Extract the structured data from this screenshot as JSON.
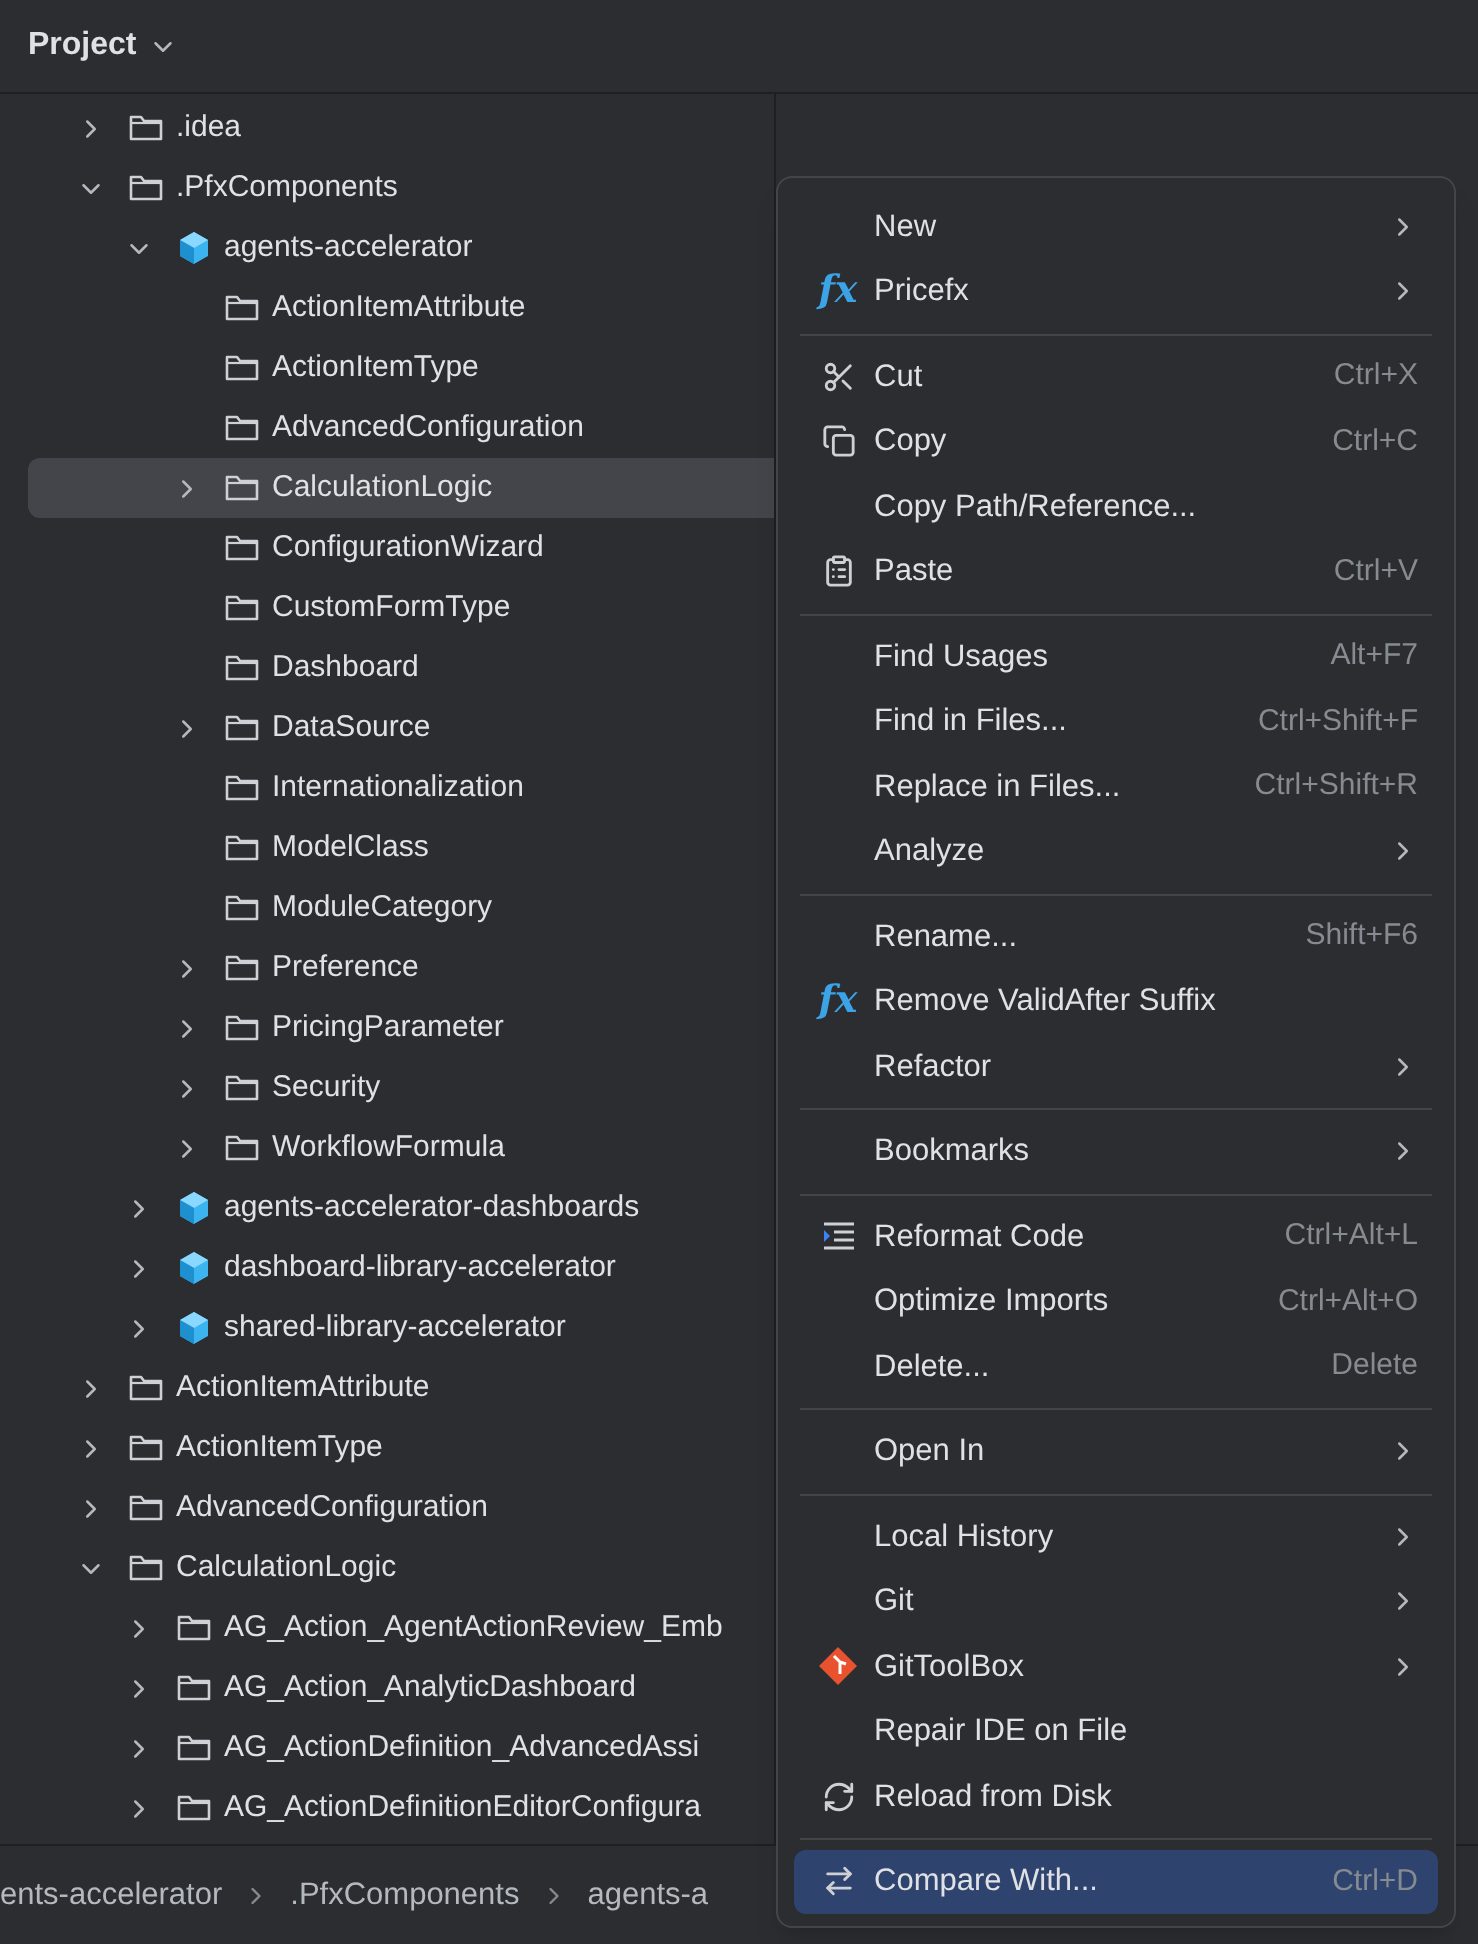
{
  "panel": {
    "title": "Project"
  },
  "tree": [
    {
      "label": ".idea",
      "kind": "folder",
      "expanded": false,
      "selected": false
    },
    {
      "label": ".PfxComponents",
      "kind": "folder",
      "expanded": true,
      "selected": false,
      "children": [
        {
          "label": "agents-accelerator",
          "kind": "module",
          "expanded": true,
          "selected": false,
          "children": [
            {
              "label": "ActionItemAttribute",
              "kind": "folder",
              "selected": false
            },
            {
              "label": "ActionItemType",
              "kind": "folder",
              "selected": false
            },
            {
              "label": "AdvancedConfiguration",
              "kind": "folder",
              "selected": false
            },
            {
              "label": "CalculationLogic",
              "kind": "folder",
              "expanded": false,
              "selected": true
            },
            {
              "label": "ConfigurationWizard",
              "kind": "folder",
              "selected": false
            },
            {
              "label": "CustomFormType",
              "kind": "folder",
              "selected": false
            },
            {
              "label": "Dashboard",
              "kind": "folder",
              "selected": false
            },
            {
              "label": "DataSource",
              "kind": "folder",
              "expanded": false,
              "selected": false
            },
            {
              "label": "Internationalization",
              "kind": "folder",
              "selected": false
            },
            {
              "label": "ModelClass",
              "kind": "folder",
              "selected": false
            },
            {
              "label": "ModuleCategory",
              "kind": "folder",
              "selected": false
            },
            {
              "label": "Preference",
              "kind": "folder",
              "expanded": false,
              "selected": false
            },
            {
              "label": "PricingParameter",
              "kind": "folder",
              "expanded": false,
              "selected": false
            },
            {
              "label": "Security",
              "kind": "folder",
              "expanded": false,
              "selected": false
            },
            {
              "label": "WorkflowFormula",
              "kind": "folder",
              "expanded": false,
              "selected": false
            }
          ]
        },
        {
          "label": "agents-accelerator-dashboards",
          "kind": "module",
          "expanded": false,
          "selected": false
        },
        {
          "label": "dashboard-library-accelerator",
          "kind": "module",
          "expanded": false,
          "selected": false
        },
        {
          "label": "shared-library-accelerator",
          "kind": "module",
          "expanded": false,
          "selected": false
        }
      ]
    },
    {
      "label": "ActionItemAttribute",
      "kind": "folder",
      "expanded": false,
      "selected": false
    },
    {
      "label": "ActionItemType",
      "kind": "folder",
      "expanded": false,
      "selected": false
    },
    {
      "label": "AdvancedConfiguration",
      "kind": "folder",
      "expanded": false,
      "selected": false
    },
    {
      "label": "CalculationLogic",
      "kind": "folder",
      "expanded": true,
      "selected": false,
      "children": [
        {
          "label": "AG_Action_AgentActionReview_Emb",
          "kind": "folder",
          "expanded": false,
          "selected": false
        },
        {
          "label": "AG_Action_AnalyticDashboard",
          "kind": "folder",
          "expanded": false,
          "selected": false
        },
        {
          "label": "AG_ActionDefinition_AdvancedAssi",
          "kind": "folder",
          "expanded": false,
          "selected": false
        },
        {
          "label": "AG_ActionDefinitionEditorConfigura",
          "kind": "folder",
          "expanded": false,
          "selected": false
        }
      ]
    }
  ],
  "breadcrumbs": [
    "ents-accelerator",
    ".PfxComponents",
    "agents-a"
  ],
  "context_menu": [
    {
      "kind": "item",
      "label": "New",
      "submenu": true,
      "selected": false
    },
    {
      "kind": "item",
      "label": "Pricefx",
      "icon_text": "fx",
      "submenu": true,
      "selected": false
    },
    {
      "kind": "separator"
    },
    {
      "kind": "item",
      "label": "Cut",
      "shortcut": "Ctrl+X",
      "selected": false
    },
    {
      "kind": "item",
      "label": "Copy",
      "shortcut": "Ctrl+C",
      "selected": false
    },
    {
      "kind": "item",
      "label": "Copy Path/Reference...",
      "selected": false
    },
    {
      "kind": "item",
      "label": "Paste",
      "shortcut": "Ctrl+V",
      "selected": false
    },
    {
      "kind": "separator"
    },
    {
      "kind": "item",
      "label": "Find Usages",
      "shortcut": "Alt+F7",
      "selected": false
    },
    {
      "kind": "item",
      "label": "Find in Files...",
      "shortcut": "Ctrl+Shift+F",
      "selected": false
    },
    {
      "kind": "item",
      "label": "Replace in Files...",
      "shortcut": "Ctrl+Shift+R",
      "selected": false
    },
    {
      "kind": "item",
      "label": "Analyze",
      "submenu": true,
      "selected": false
    },
    {
      "kind": "separator"
    },
    {
      "kind": "item",
      "label": "Rename...",
      "shortcut": "Shift+F6",
      "selected": false
    },
    {
      "kind": "item",
      "label": "Remove ValidAfter Suffix",
      "icon_text": "fx",
      "selected": false
    },
    {
      "kind": "item",
      "label": "Refactor",
      "submenu": true,
      "selected": false
    },
    {
      "kind": "separator"
    },
    {
      "kind": "item",
      "label": "Bookmarks",
      "submenu": true,
      "selected": false
    },
    {
      "kind": "separator"
    },
    {
      "kind": "item",
      "label": "Reformat Code",
      "shortcut": "Ctrl+Alt+L",
      "selected": false
    },
    {
      "kind": "item",
      "label": "Optimize Imports",
      "shortcut": "Ctrl+Alt+O",
      "selected": false
    },
    {
      "kind": "item",
      "label": "Delete...",
      "shortcut": "Delete",
      "selected": false
    },
    {
      "kind": "separator"
    },
    {
      "kind": "item",
      "label": "Open In",
      "submenu": true,
      "selected": false
    },
    {
      "kind": "separator"
    },
    {
      "kind": "item",
      "label": "Local History",
      "submenu": true,
      "selected": false
    },
    {
      "kind": "item",
      "label": "Git",
      "submenu": true,
      "selected": false
    },
    {
      "kind": "item",
      "label": "GitToolBox",
      "submenu": true,
      "selected": false
    },
    {
      "kind": "item",
      "label": "Repair IDE on File",
      "selected": false
    },
    {
      "kind": "item",
      "label": "Reload from Disk",
      "selected": false
    },
    {
      "kind": "separator"
    },
    {
      "kind": "item",
      "label": "Compare With...",
      "shortcut": "Ctrl+D",
      "selected": true
    }
  ]
}
